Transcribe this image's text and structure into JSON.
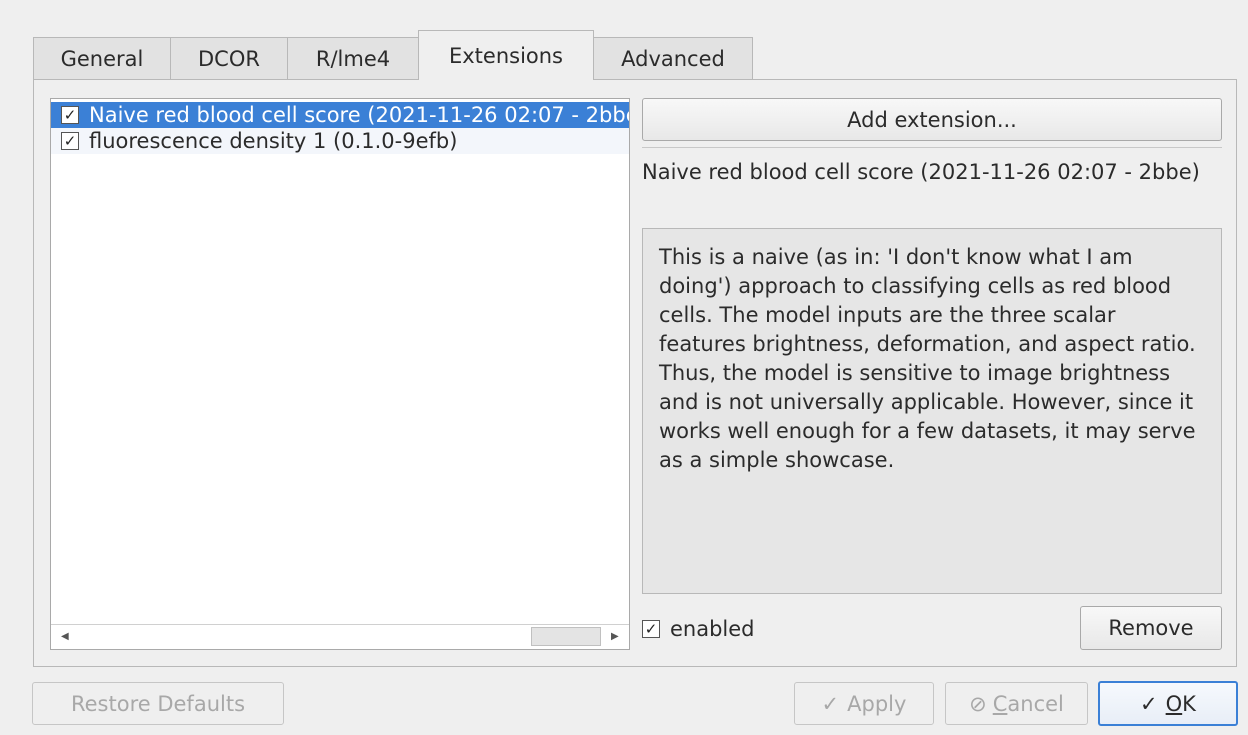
{
  "tabs": [
    {
      "label": "General",
      "active": false
    },
    {
      "label": "DCOR",
      "active": false
    },
    {
      "label": "R/lme4",
      "active": false
    },
    {
      "label": "Extensions",
      "active": true
    },
    {
      "label": "Advanced",
      "active": false
    }
  ],
  "extensions": {
    "items": [
      {
        "label": "Naive red blood cell score (2021-11-26 02:07 - 2bbe)",
        "checked": true,
        "selected": true
      },
      {
        "label": "fluorescence density 1 (0.1.0-9efb)",
        "checked": true,
        "selected": false
      }
    ],
    "add_button": "Add extension...",
    "selected_title": "Naive red blood cell score (2021-11-26 02:07 - 2bbe)",
    "description": "This is a naive (as in: 'I don't know what I am doing') approach to classifying cells as red blood cells. The model inputs are the three scalar features brightness, deformation, and aspect ratio. Thus, the model is sensitive to image brightness and is not universally applicable. However, since it works well enough for a few datasets, it may serve as a simple showcase.",
    "enabled_label": "enabled",
    "enabled_checked": true,
    "remove_button": "Remove"
  },
  "footer": {
    "restore_defaults": "Restore Defaults",
    "apply": "Apply",
    "cancel_prefix": "",
    "cancel_mnemonic": "C",
    "cancel_rest": "ancel",
    "ok_mnemonic": "O",
    "ok_rest": "K"
  },
  "icons": {
    "check": "✓",
    "cancel": "⊘",
    "checkbox_mark": "✓",
    "scroll_left": "◀",
    "scroll_right": "▶"
  }
}
